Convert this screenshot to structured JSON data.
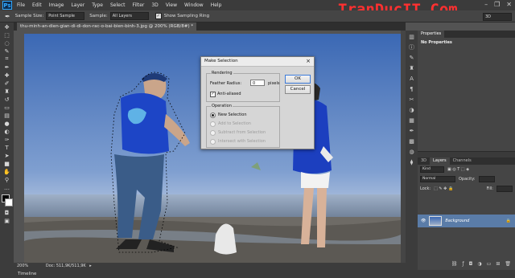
{
  "menubar": {
    "logo": "Ps",
    "items": [
      "File",
      "Edit",
      "Image",
      "Layer",
      "Type",
      "Select",
      "Filter",
      "3D",
      "View",
      "Window",
      "Help"
    ],
    "window_controls": [
      "–",
      "❐",
      "✕"
    ]
  },
  "watermark": "TranDucIT.Com",
  "options": {
    "sample_size_label": "Sample Size:",
    "sample_size_value": "Point Sample",
    "sample_label": "Sample:",
    "sample_value": "All Layers",
    "show_ring_label": "Show Sampling Ring",
    "workspace": "3D"
  },
  "document": {
    "tab_title": "thu-minh-an-dien-gian-di-di-don-rac-o-bai-bien-binh-3.jpg @ 200% (RGB/8#) *",
    "zoom": "200%",
    "doc_info": "Doc: 511,9K/511,9K"
  },
  "timeline_label": "Timeline",
  "properties": {
    "tab_label": "Properties",
    "body_text": "No Properties"
  },
  "layers": {
    "tabs": [
      "3D",
      "Layers",
      "Channels"
    ],
    "kind_label": "Kind",
    "blend_mode": "Normal",
    "opacity_label": "Opacity:",
    "lock_label": "Lock:",
    "fill_label": "Fill:",
    "layer_name": "Background"
  },
  "dialog": {
    "title": "Make Selection",
    "rendering_legend": "Rendering",
    "feather_label": "Feather Radius:",
    "feather_value": "0",
    "feather_unit": "pixels",
    "anti_aliased_label": "Anti-aliased",
    "operation_legend": "Operation",
    "options": [
      "New Selection",
      "Add to Selection",
      "Subtract from Selection",
      "Intersect with Selection"
    ],
    "ok_label": "OK",
    "cancel_label": "Cancel"
  },
  "colors": {
    "accent": "#31a8ff",
    "watermark": "#ff3030",
    "sky_top": "#3b68b4",
    "layer_selected": "#5a7ca8"
  }
}
